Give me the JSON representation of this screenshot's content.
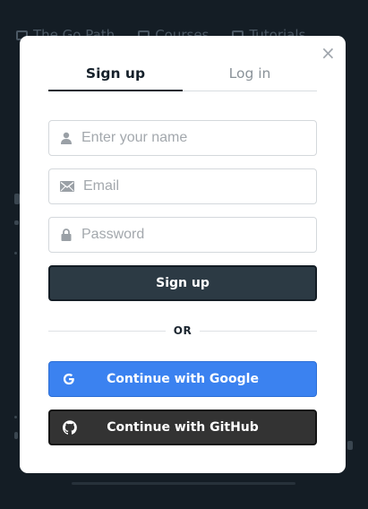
{
  "background_nav": {
    "items": [
      {
        "label": "The Go Path",
        "icon": "map-icon"
      },
      {
        "label": "Courses",
        "icon": "briefcase-icon"
      },
      {
        "label": "Tutorials",
        "icon": "book-icon"
      }
    ]
  },
  "modal": {
    "close_symbol": "×",
    "tabs": [
      {
        "label": "Sign up",
        "active": true
      },
      {
        "label": "Log in",
        "active": false
      }
    ],
    "fields": {
      "name": {
        "placeholder": "Enter your name",
        "icon": "user-icon"
      },
      "email": {
        "placeholder": "Email",
        "icon": "envelope-icon"
      },
      "password": {
        "placeholder": "Password",
        "icon": "lock-icon"
      }
    },
    "signup_button": "Sign up",
    "divider_text": "OR",
    "google_button": {
      "label": "Continue with Google",
      "icon": "google-icon"
    },
    "github_button": {
      "label": "Continue with GitHub",
      "icon": "github-icon"
    }
  },
  "colors": {
    "backdrop": "#141d25",
    "primary_dark": "#2c3a44",
    "google_blue": "#3b82f0",
    "github_dark": "#333333"
  }
}
